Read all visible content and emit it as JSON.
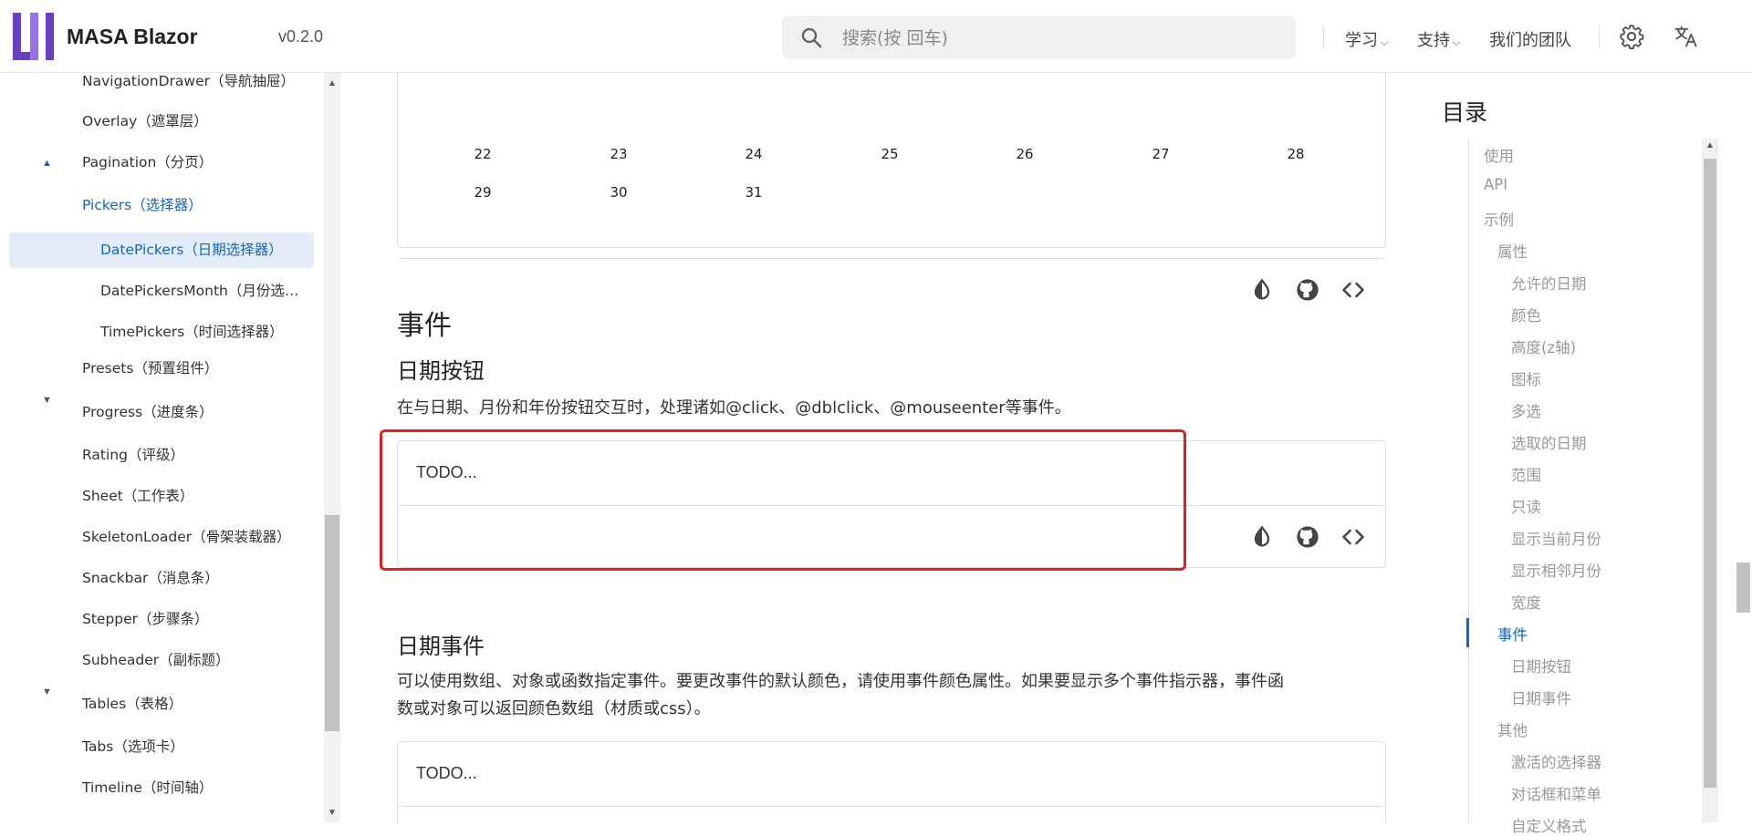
{
  "header": {
    "brand": "MASA Blazor",
    "version": "v0.2.0",
    "search_placeholder": "搜索(按 回车)",
    "nav": [
      {
        "label": "学习"
      },
      {
        "label": "支持"
      },
      {
        "label": "我们的团队"
      }
    ]
  },
  "sidebar": {
    "items": [
      {
        "label": "NavigationDrawer（导航抽屉）"
      },
      {
        "label": "Overlay（遮罩层）"
      },
      {
        "label": "Pagination（分页）"
      },
      {
        "label": "Pickers（选择器）"
      },
      {
        "label": "DatePickers（日期选择器）"
      },
      {
        "label": "DatePickersMonth（月份选…"
      },
      {
        "label": "TimePickers（时间选择器）"
      },
      {
        "label": "Presets（预置组件）"
      },
      {
        "label": "Progress（进度条）"
      },
      {
        "label": "Rating（评级）"
      },
      {
        "label": "Sheet（工作表）"
      },
      {
        "label": "SkeletonLoader（骨架装载器）"
      },
      {
        "label": "Snackbar（消息条）"
      },
      {
        "label": "Stepper（步骤条）"
      },
      {
        "label": "Subheader（副标题）"
      },
      {
        "label": "Tables（表格）"
      },
      {
        "label": "Tabs（选项卡）"
      },
      {
        "label": "Timeline（时间轴）"
      }
    ]
  },
  "calendar": {
    "row1": [
      "22",
      "23",
      "24",
      "25",
      "26",
      "27",
      "28"
    ],
    "row2": [
      "29",
      "30",
      "31"
    ]
  },
  "main": {
    "section_title": "事件",
    "sub1_title": "日期按钮",
    "sub1_desc": "在与日期、月份和年份按钮交互时，处理诸如@click、@dblclick、@mouseenter等事件。",
    "sub1_demo": "TODO...",
    "sub2_title": "日期事件",
    "sub2_desc_line1": "可以使用数组、对象或函数指定事件。要更改事件的默认颜色，请使用事件颜色属性。如果要显示多个事件指示器，事件函",
    "sub2_desc_line2": "数或对象可以返回颜色数组（材质或css）。",
    "sub2_demo": "TODO..."
  },
  "toc": {
    "title": "目录",
    "items": [
      {
        "label": "使用"
      },
      {
        "label": "API"
      },
      {
        "label": "示例"
      },
      {
        "label": "属性"
      },
      {
        "label": "允许的日期"
      },
      {
        "label": "颜色"
      },
      {
        "label": "高度(z轴)"
      },
      {
        "label": "图标"
      },
      {
        "label": "多选"
      },
      {
        "label": "选取的日期"
      },
      {
        "label": "范围"
      },
      {
        "label": "只读"
      },
      {
        "label": "显示当前月份"
      },
      {
        "label": "显示相邻月份"
      },
      {
        "label": "宽度"
      },
      {
        "label": "事件"
      },
      {
        "label": "日期按钮"
      },
      {
        "label": "日期事件"
      },
      {
        "label": "其他"
      },
      {
        "label": "激活的选择器"
      },
      {
        "label": "对话框和菜单"
      },
      {
        "label": "自定义格式"
      }
    ]
  },
  "colors": {
    "accent": "#1565c0",
    "active_bg": "#e3ecf8",
    "highlight_box": "#e02020",
    "logo": "#6a3fc1"
  }
}
